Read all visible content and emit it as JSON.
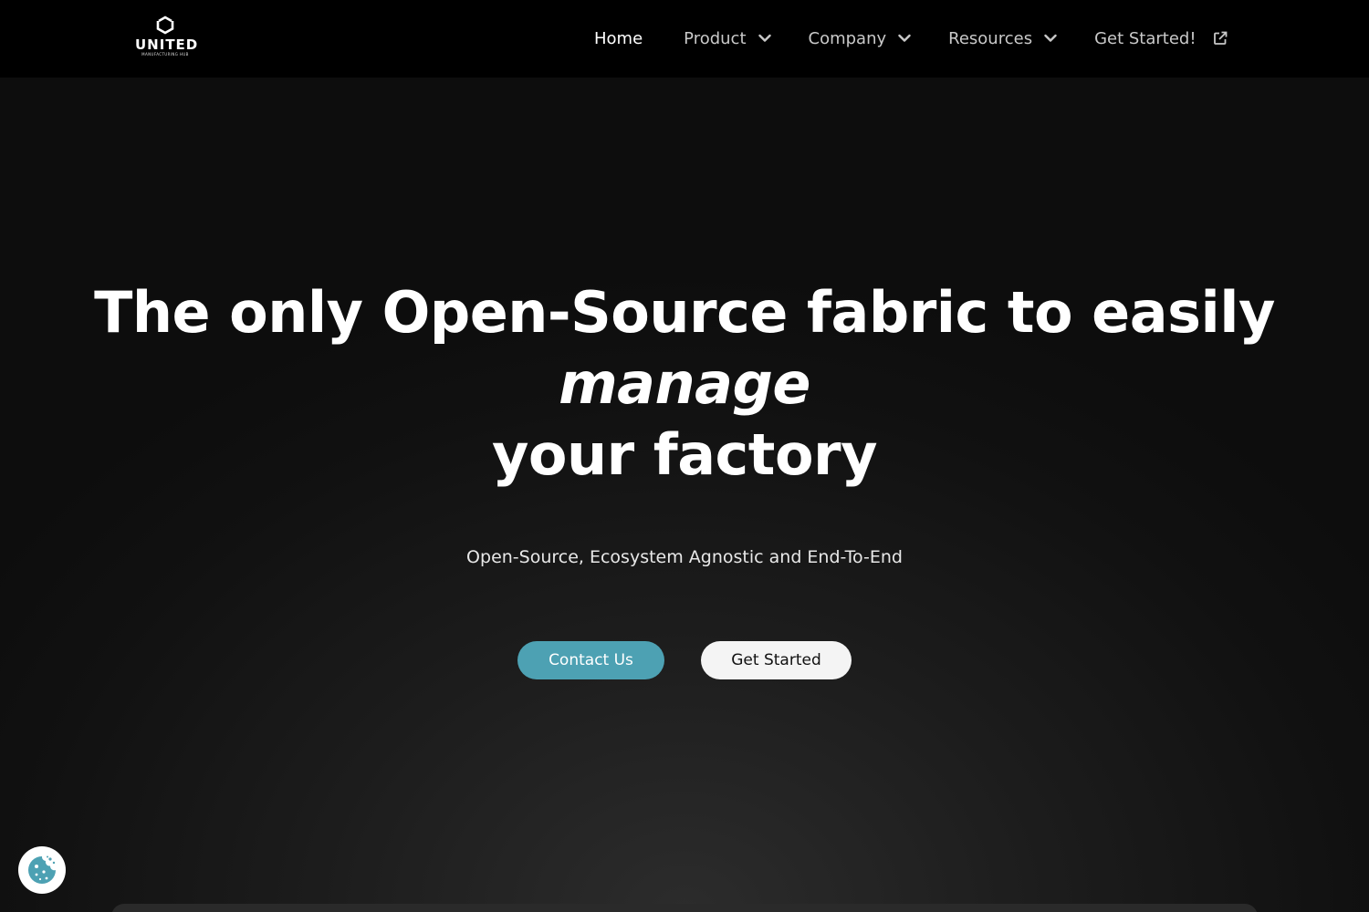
{
  "nav": {
    "logo": {
      "word": "UNITED",
      "sub": "MANUFACTURING HUB"
    },
    "items": [
      {
        "label": "Home",
        "icon": null
      },
      {
        "label": "Product",
        "icon": "chevron-down-icon"
      },
      {
        "label": "Company",
        "icon": "chevron-down-icon"
      },
      {
        "label": "Resources",
        "icon": "chevron-down-icon"
      },
      {
        "label": "Get Started!",
        "icon": "external-link-icon"
      }
    ]
  },
  "hero": {
    "title_line1": "The only Open-Source fabric to easily",
    "title_line2": "manage",
    "title_line3": "your factory",
    "subtitle": "Open-Source, Ecosystem Agnostic and End-To-End",
    "primary_button": "Contact Us",
    "secondary_button": "Get Started"
  },
  "cookie": {
    "icon": "cookie-icon"
  },
  "colors": {
    "accent": "#4da1b3",
    "navbar_bg": "#000000",
    "secondary_button_bg": "#f4f4f4"
  }
}
